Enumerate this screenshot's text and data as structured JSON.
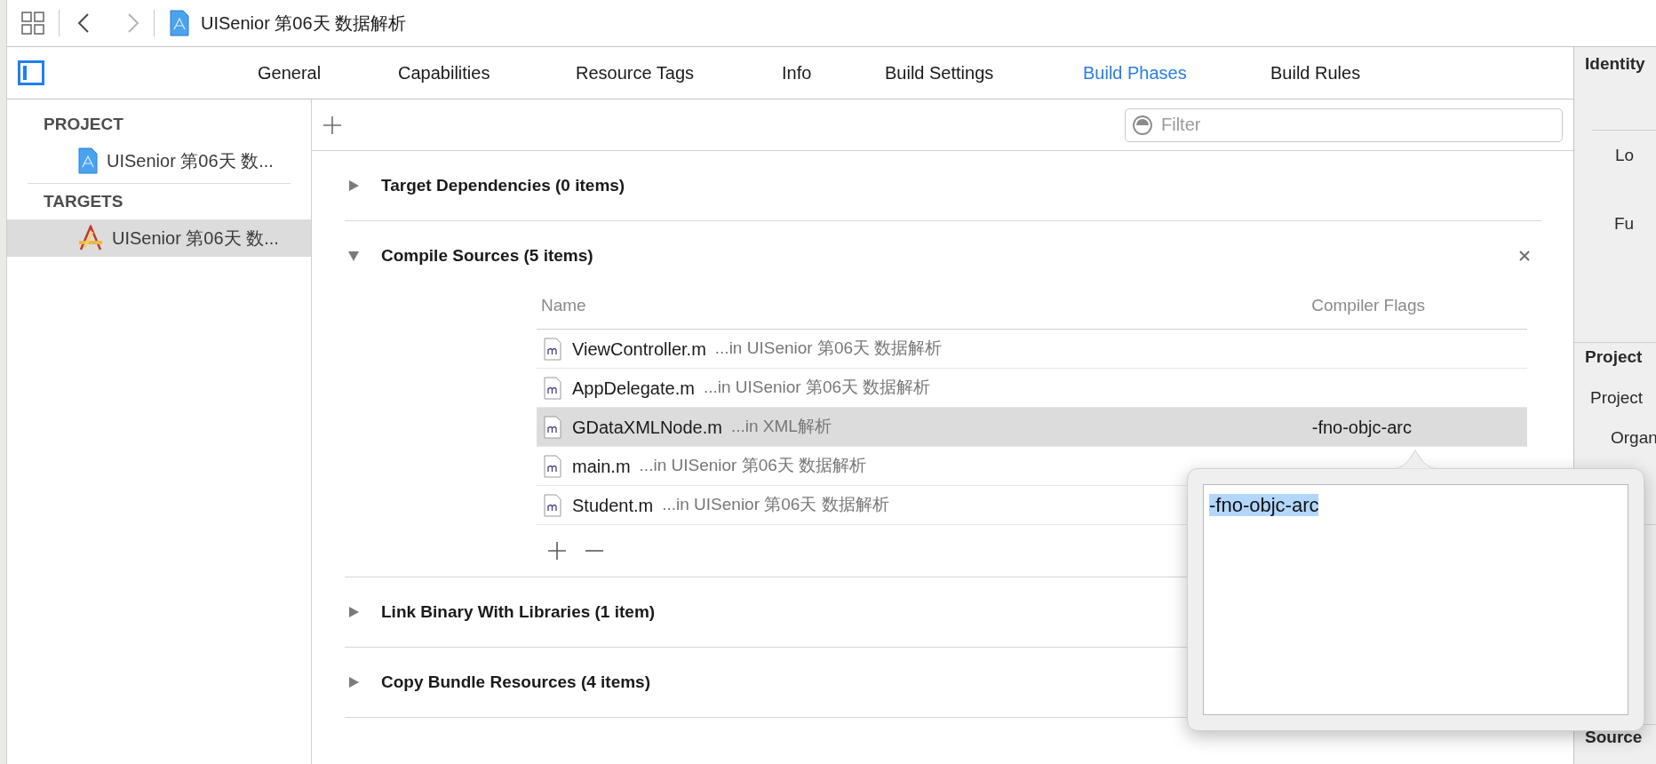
{
  "toolbar": {
    "back_enabled": true,
    "forward_enabled": false,
    "breadcrumb": "UISenior 第06天 数据解析"
  },
  "tabs": [
    {
      "label": "General",
      "selected": false
    },
    {
      "label": "Capabilities",
      "selected": false
    },
    {
      "label": "Resource Tags",
      "selected": false
    },
    {
      "label": "Info",
      "selected": false
    },
    {
      "label": "Build Settings",
      "selected": false
    },
    {
      "label": "Build Phases",
      "selected": true
    },
    {
      "label": "Build Rules",
      "selected": false
    }
  ],
  "sidebar": {
    "sections": [
      {
        "title": "PROJECT",
        "items": [
          {
            "label": "UISenior 第06天 数...",
            "kind": "project",
            "selected": false
          }
        ]
      },
      {
        "title": "TARGETS",
        "items": [
          {
            "label": "UISenior 第06天 数...",
            "kind": "target",
            "selected": true
          }
        ]
      }
    ]
  },
  "filter": {
    "placeholder": "Filter"
  },
  "phases": [
    {
      "title": "Target Dependencies (0 items)",
      "expanded": false
    },
    {
      "title": "Compile Sources (5 items)",
      "expanded": true,
      "columns": [
        "Name",
        "Compiler Flags"
      ],
      "rows": [
        {
          "file": "ViewController.m",
          "location": "...in UISenior 第06天 数据解析",
          "selected": false
        },
        {
          "file": "AppDelegate.m",
          "location": "...in UISenior 第06天 数据解析",
          "selected": false
        },
        {
          "file": "GDataXMLNode.m",
          "location": "...in XML解析",
          "flags": "-fno-objc-arc",
          "selected": true
        },
        {
          "file": "main.m",
          "location": "...in UISenior 第06天 数据解析",
          "selected": false
        },
        {
          "file": "Student.m",
          "location": "...in UISenior 第06天 数据解析",
          "selected": false
        }
      ]
    },
    {
      "title": "Link Binary With Libraries (1 item)",
      "expanded": false
    },
    {
      "title": "Copy Bundle Resources (4 items)",
      "expanded": false
    }
  ],
  "popover": {
    "value": "-fno-objc-arc"
  },
  "inspector": [
    {
      "text": "Identity",
      "kind": "heading"
    },
    {
      "text": "Lo",
      "kind": "label"
    },
    {
      "text": "Fu",
      "kind": "label"
    },
    {
      "text": "Project",
      "kind": "heading"
    },
    {
      "text": "Project",
      "kind": "label"
    },
    {
      "text": "Organ",
      "kind": "label"
    },
    {
      "text": "Source",
      "kind": "heading"
    }
  ]
}
